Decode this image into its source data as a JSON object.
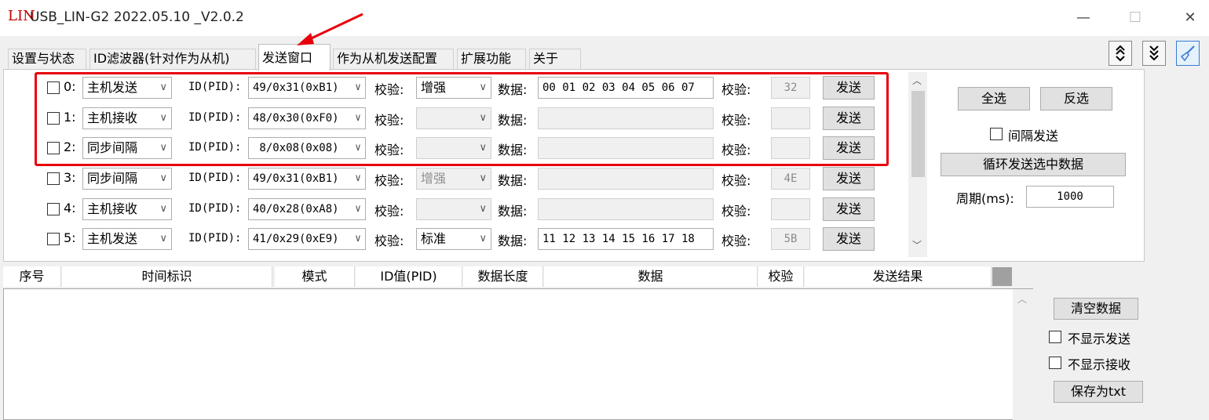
{
  "window": {
    "logo_main": "LIN",
    "title": "USB_LIN-G2 2022.05.10 _V2.0.2",
    "min_glyph": "—",
    "max_glyph": "☐",
    "close_glyph": "✕"
  },
  "tabs": [
    {
      "label": "设置与状态"
    },
    {
      "label": "ID滤波器(针对作为从机)"
    },
    {
      "label": "发送窗口",
      "active": true
    },
    {
      "label": "作为从机发送配置"
    },
    {
      "label": "扩展功能"
    },
    {
      "label": "关于"
    }
  ],
  "rows": [
    {
      "index": "0:",
      "mode": "主机发送",
      "id_label": "ID(PID):",
      "id": "49/0x31(0xB1)",
      "check_label": "校验:",
      "check_type": "增强",
      "check_type_enabled": true,
      "data_label": "数据:",
      "data": "00 01 02 03 04 05 06 07",
      "data_enabled": true,
      "checksum_label": "校验:",
      "checksum": "32",
      "send": "发送"
    },
    {
      "index": "1:",
      "mode": "主机接收",
      "id_label": "ID(PID):",
      "id": "48/0x30(0xF0)",
      "check_label": "校验:",
      "check_type": "",
      "check_type_enabled": false,
      "data_label": "数据:",
      "data": "",
      "data_enabled": false,
      "checksum_label": "校验:",
      "checksum": "",
      "send": "发送"
    },
    {
      "index": "2:",
      "mode": "同步间隔",
      "id_label": "ID(PID):",
      "id": " 8/0x08(0x08)",
      "check_label": "校验:",
      "check_type": "",
      "check_type_enabled": false,
      "data_label": "数据:",
      "data": "",
      "data_enabled": false,
      "checksum_label": "校验:",
      "checksum": "",
      "send": "发送"
    },
    {
      "index": "3:",
      "mode": "同步间隔",
      "id_label": "ID(PID):",
      "id": "49/0x31(0xB1)",
      "check_label": "校验:",
      "check_type": "增强",
      "check_type_enabled": false,
      "data_label": "数据:",
      "data": "",
      "data_enabled": false,
      "checksum_label": "校验:",
      "checksum": "4E",
      "send": "发送"
    },
    {
      "index": "4:",
      "mode": "主机接收",
      "id_label": "ID(PID):",
      "id": "40/0x28(0xA8)",
      "check_label": "校验:",
      "check_type": "",
      "check_type_enabled": false,
      "data_label": "数据:",
      "data": "",
      "data_enabled": false,
      "checksum_label": "校验:",
      "checksum": "",
      "send": "发送"
    },
    {
      "index": "5:",
      "mode": "主机发送",
      "id_label": "ID(PID):",
      "id": "41/0x29(0xE9)",
      "check_label": "校验:",
      "check_type": "标准",
      "check_type_enabled": true,
      "data_label": "数据:",
      "data": "11 12 13 14 15 16 17 18",
      "data_enabled": true,
      "checksum_label": "校验:",
      "checksum": "5B",
      "send": "发送"
    }
  ],
  "side_panel": {
    "select_all": "全选",
    "invert": "反选",
    "interval_send": "间隔发送",
    "loop_send": "循环发送选中数据",
    "period_label": "周期(ms):",
    "period_value": "1000"
  },
  "table": {
    "columns": [
      "序号",
      "时间标识",
      "模式",
      "ID值(PID)",
      "数据长度",
      "数据",
      "校验",
      "发送结果"
    ]
  },
  "bottom_panel": {
    "clear": "清空数据",
    "hide_send": "不显示发送",
    "hide_recv": "不显示接收",
    "save_txt": "保存为txt"
  },
  "colors": {
    "highlight": "#e8000b",
    "logo": "#c00000",
    "toolbar_icon_accent": "#3a7bd5"
  },
  "icons": [
    "collapse-icon",
    "expand-icon",
    "clean-icon"
  ]
}
